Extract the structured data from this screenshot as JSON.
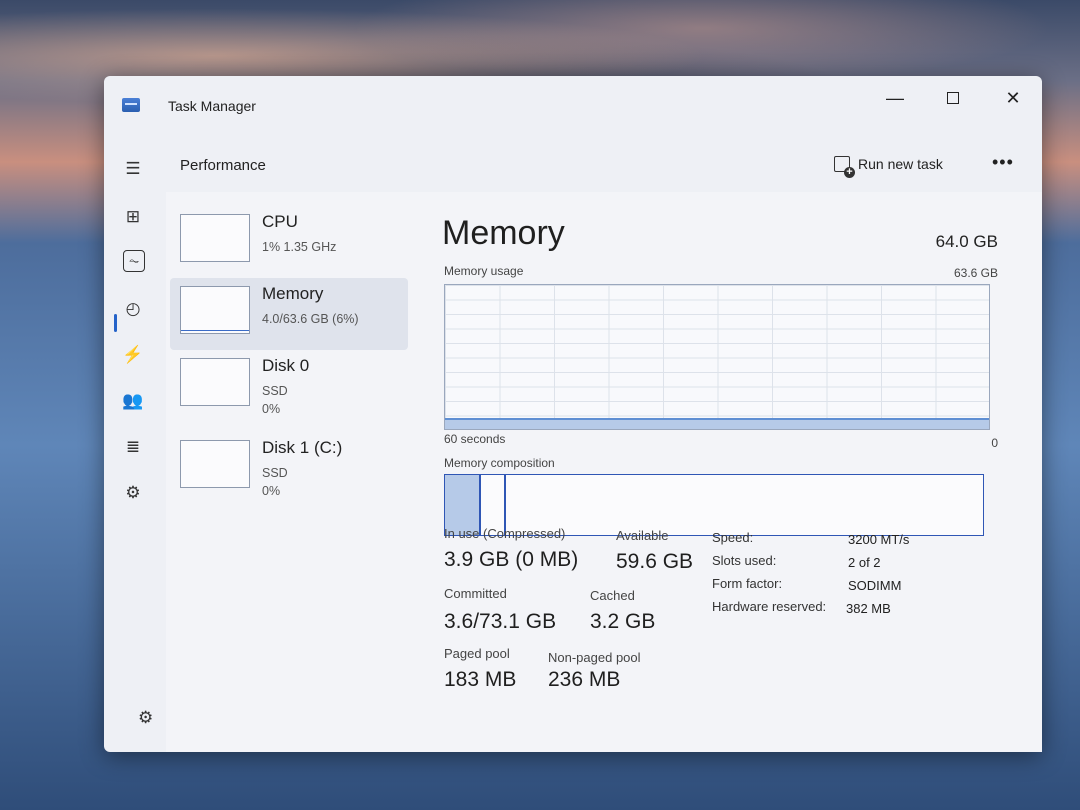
{
  "window": {
    "title": "Task Manager",
    "controls": {
      "minimize": "—",
      "close": "✕"
    }
  },
  "header": {
    "page_title": "Performance",
    "run_new_task": "Run new task",
    "more": "•••"
  },
  "nav": {
    "menu_icon": "☰",
    "processes_icon": "⊞",
    "performance_icon": "⏦",
    "history_icon": "◴",
    "startup_icon": "⚡",
    "users_icon": "👥",
    "details_icon": "≣",
    "services_icon": "⚙",
    "settings_icon": "⚙"
  },
  "devices": [
    {
      "name": "CPU",
      "line1": "1%  1.35 GHz",
      "line2": ""
    },
    {
      "name": "Memory",
      "line1": "4.0/63.6 GB (6%)",
      "line2": ""
    },
    {
      "name": "Disk 0",
      "line1": "SSD",
      "line2": "0%"
    },
    {
      "name": "Disk 1 (C:)",
      "line1": "SSD",
      "line2": "0%"
    }
  ],
  "memory": {
    "title": "Memory",
    "total": "64.0 GB",
    "usage_label": "Memory usage",
    "max_label": "63.6 GB",
    "time_label": "60 seconds",
    "zero_label": "0",
    "composition_label": "Memory composition",
    "usage_fraction": 0.06,
    "composition": {
      "in_use_fraction": 0.064,
      "modified_fraction": 0.046
    },
    "stats": {
      "in_use_label": "In use (Compressed)",
      "in_use_value": "3.9 GB (0 MB)",
      "available_label": "Available",
      "available_value": "59.6 GB",
      "committed_label": "Committed",
      "committed_value": "3.6/73.1 GB",
      "cached_label": "Cached",
      "cached_value": "3.2 GB",
      "paged_label": "Paged pool",
      "paged_value": "183 MB",
      "nonpaged_label": "Non-paged pool",
      "nonpaged_value": "236 MB"
    },
    "specs": {
      "speed_label": "Speed:",
      "speed_value": "3200 MT/s",
      "slots_label": "Slots used:",
      "slots_value": "2 of 2",
      "form_label": "Form factor:",
      "form_value": "SODIMM",
      "hwres_label": "Hardware reserved:",
      "hwres_value": "382 MB"
    }
  },
  "colors": {
    "accent": "#2f56b5",
    "graph_fill": "#b6cae8",
    "window_bg": "#eef0f5"
  }
}
